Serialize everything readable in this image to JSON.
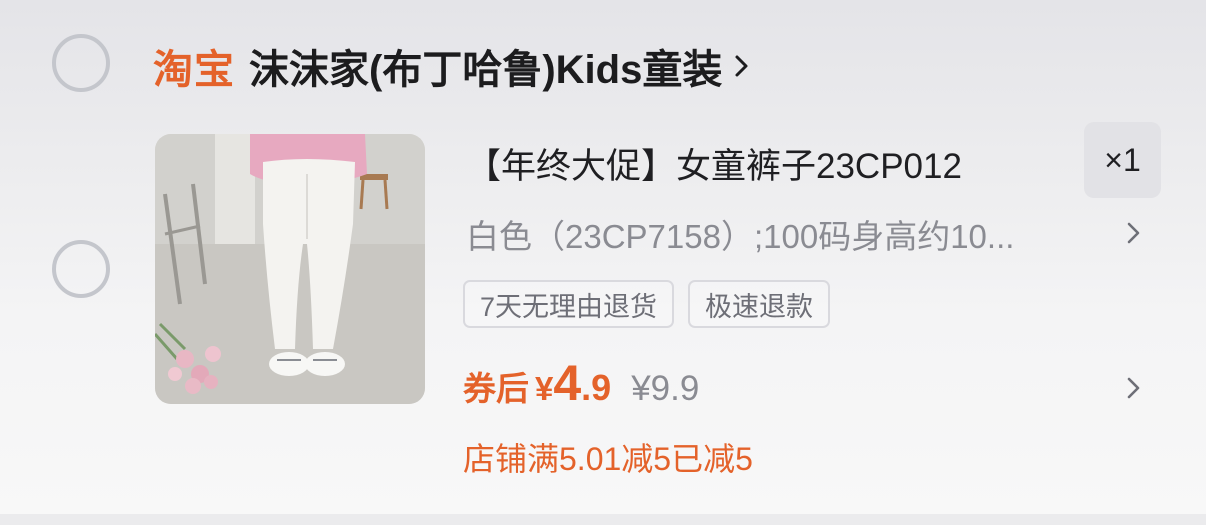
{
  "shop": {
    "brand": "淘宝",
    "name": "沫沫家(布丁哈鲁)Kids童装"
  },
  "item": {
    "title": "【年终大促】女童裤子23CP012",
    "quantity": "×1",
    "sku": "白色（23CP7158）;100码身高约10...",
    "tags": [
      "7天无理由退货",
      "极速退款"
    ],
    "coupon_label": "券后",
    "currency": "¥",
    "price_int": "4",
    "price_dec": ".9",
    "original_price": "¥9.9",
    "discount_note": "店铺满5.01减5已减5"
  },
  "icons": {
    "shop_chevron": "chevron-right-icon",
    "sku_chevron": "chevron-right-icon",
    "price_chevron": "chevron-right-icon"
  },
  "colors": {
    "accent": "#e4622a",
    "text_primary": "#1f1f22",
    "text_secondary": "#8a8b92",
    "radio_border": "#c4c6cc"
  }
}
